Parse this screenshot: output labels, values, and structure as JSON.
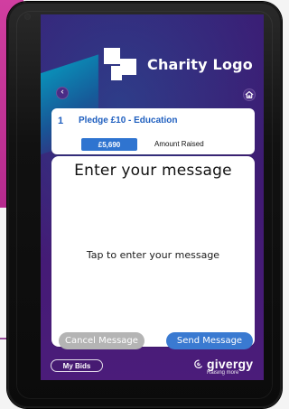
{
  "header": {
    "logo_text": "Charity Logo",
    "back_icon": "chevron-left-icon",
    "home_icon": "home-icon"
  },
  "pledge": {
    "number": "1",
    "title": "Pledge £10 - Education",
    "amount_raised_value": "£5,690",
    "amount_raised_label": "Amount Raised"
  },
  "message": {
    "title": "Enter your message",
    "tap_text": "Tap to enter your message"
  },
  "actions": {
    "cancel_label": "Cancel Message",
    "send_label": "Send Message"
  },
  "footer": {
    "my_bids_label": "My Bids",
    "brand_name": "givergy",
    "brand_tagline": "Raising more",
    "brand_icon": "givergy-logo-icon"
  },
  "colors": {
    "accent_blue": "#3a7ad1",
    "pledge_blue": "#1f5fbf",
    "cancel_gray": "#b4b4b4",
    "screen_purple": "#3f1a72",
    "background_magenta": "#d13ea0"
  }
}
